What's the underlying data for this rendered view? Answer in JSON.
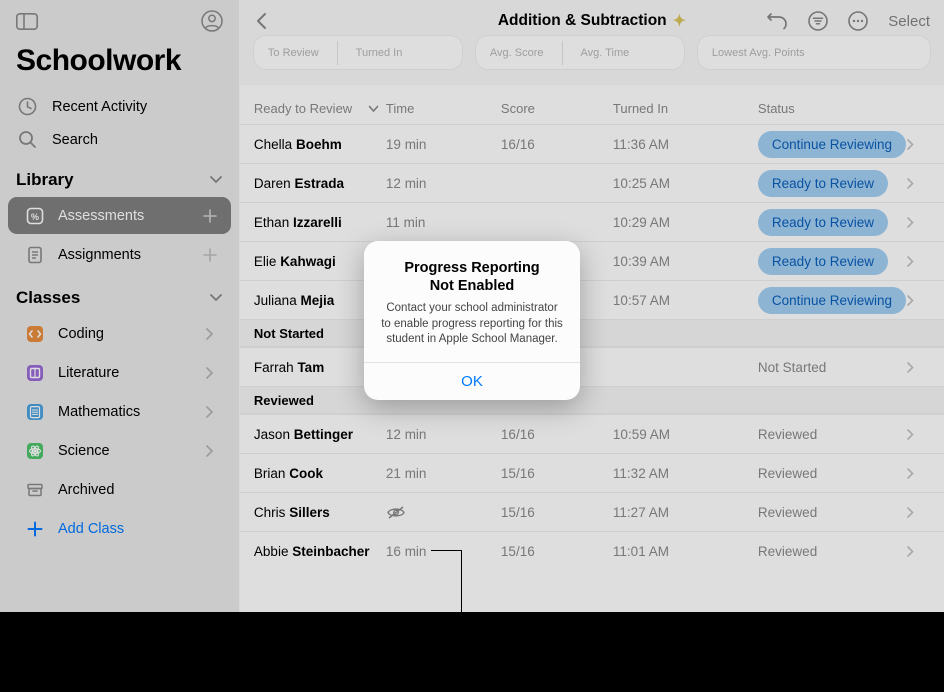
{
  "app": {
    "title": "Schoolwork"
  },
  "nav": {
    "recent": "Recent Activity",
    "search": "Search"
  },
  "library": {
    "header": "Library",
    "assessments": "Assessments",
    "assignments": "Assignments"
  },
  "classes": {
    "header": "Classes",
    "items": [
      {
        "label": "Coding"
      },
      {
        "label": "Literature"
      },
      {
        "label": "Mathematics"
      },
      {
        "label": "Science"
      },
      {
        "label": "Archived"
      }
    ],
    "addClass": "Add Class"
  },
  "header": {
    "title": "Addition & Subtraction",
    "select": "Select"
  },
  "summary": {
    "a1": "To Review",
    "a2": "Turned In",
    "b1": "Avg. Score",
    "b2": "Avg. Time",
    "c1": "Lowest Avg. Points"
  },
  "table": {
    "columns": {
      "ready": "Ready to Review",
      "time": "Time",
      "score": "Score",
      "turnedIn": "Turned In",
      "status": "Status"
    },
    "groups": {
      "notStarted": "Not Started",
      "reviewed": "Reviewed"
    },
    "rowsReady": [
      {
        "first": "Chella",
        "last": "Boehm",
        "time": "19 min",
        "score": "16/16",
        "turnedIn": "11:36 AM",
        "status": "Continue Reviewing"
      },
      {
        "first": "Daren",
        "last": "Estrada",
        "time": "12 min",
        "score": "",
        "turnedIn": "10:25 AM",
        "status": "Ready to Review"
      },
      {
        "first": "Ethan",
        "last": "Izzarelli",
        "time": "11 min",
        "score": "",
        "turnedIn": "10:29 AM",
        "status": "Ready to Review"
      },
      {
        "first": "Elie",
        "last": "Kahwagi",
        "time": "",
        "score": "",
        "turnedIn": "10:39 AM",
        "status": "Ready to Review"
      },
      {
        "first": "Juliana",
        "last": "Mejia",
        "time": "",
        "score": "",
        "turnedIn": "10:57 AM",
        "status": "Continue Reviewing"
      }
    ],
    "rowsNotStarted": [
      {
        "first": "Farrah",
        "last": "Tam",
        "statusText": "Not Started"
      }
    ],
    "rowsReviewed": [
      {
        "first": "Jason",
        "last": "Bettinger",
        "time": "12 min",
        "score": "16/16",
        "turnedIn": "10:59 AM",
        "statusText": "Reviewed"
      },
      {
        "first": "Brian",
        "last": "Cook",
        "time": "21 min",
        "score": "15/16",
        "turnedIn": "11:32 AM",
        "statusText": "Reviewed"
      },
      {
        "first": "Chris",
        "last": "Sillers",
        "time": "",
        "score": "15/16",
        "turnedIn": "11:27 AM",
        "statusText": "Reviewed",
        "eyeOff": true
      },
      {
        "first": "Abbie",
        "last": "Steinbacher",
        "time": "16 min",
        "score": "15/16",
        "turnedIn": "11:01 AM",
        "statusText": "Reviewed"
      }
    ]
  },
  "modal": {
    "title1": "Progress Reporting",
    "title2": "Not Enabled",
    "message": "Contact your school administrator to enable progress reporting for this student in Apple School Manager.",
    "ok": "OK"
  },
  "icons": {
    "clock": "clock-icon",
    "search": "search-icon",
    "assessment": "assessment-icon",
    "assignment": "assignment-icon",
    "coding": "coding-icon",
    "literature": "literature-icon",
    "math": "math-icon",
    "science": "science-icon",
    "archived": "archived-icon"
  },
  "colors": {
    "accent": "#007aff",
    "pillBg": "#a4cff4",
    "pillText": "#0a5fba"
  }
}
